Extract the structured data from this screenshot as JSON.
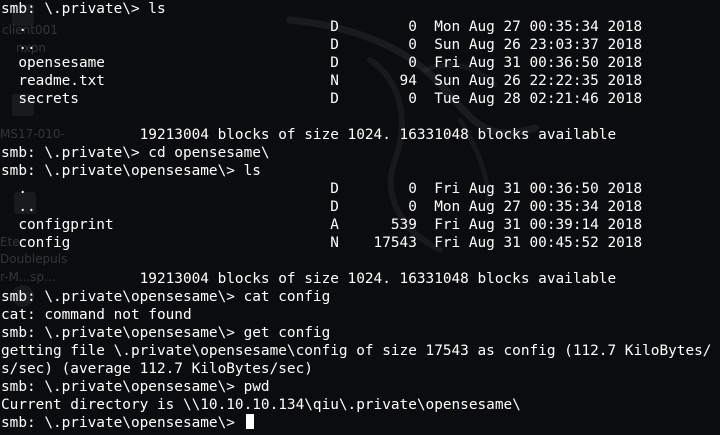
{
  "window": {
    "background": "#0b0c0e",
    "foreground": "#ffffff"
  },
  "desktop_ghost_labels": [
    "client001",
    "nxpn",
    "MS17-010-",
    "Ete",
    "Doublepuls",
    "r-M...sp..."
  ],
  "terminal_lines": [
    "smb: \\.private\\> ls",
    "  .                                   D        0  Mon Aug 27 00:35:34 2018",
    "  ..                                  D        0  Sun Aug 26 23:03:37 2018",
    "  opensesame                          D        0  Fri Aug 31 00:36:50 2018",
    "  readme.txt                          N       94  Sun Aug 26 22:22:35 2018",
    "  secrets                             D        0  Tue Aug 28 02:21:46 2018",
    "",
    "                19213004 blocks of size 1024. 16331048 blocks available",
    "smb: \\.private\\> cd opensesame\\",
    "smb: \\.private\\opensesame\\> ls",
    "  .                                   D        0  Fri Aug 31 00:36:50 2018",
    "  ..                                  D        0  Mon Aug 27 00:35:34 2018",
    "  configprint                         A      539  Fri Aug 31 00:39:14 2018",
    "  config                              N    17543  Fri Aug 31 00:45:52 2018",
    "",
    "                19213004 blocks of size 1024. 16331048 blocks available",
    "smb: \\.private\\opensesame\\> cat config",
    "cat: command not found",
    "smb: \\.private\\opensesame\\> get config",
    "getting file \\.private\\opensesame\\config of size 17543 as config (112.7 KiloBytes/",
    "s/sec) (average 112.7 KiloBytes/sec)",
    "smb: \\.private\\opensesame\\> pwd",
    "Current directory is \\\\10.10.10.134\\qiu\\.private\\opensesame\\",
    "smb: \\.private\\opensesame\\> "
  ]
}
